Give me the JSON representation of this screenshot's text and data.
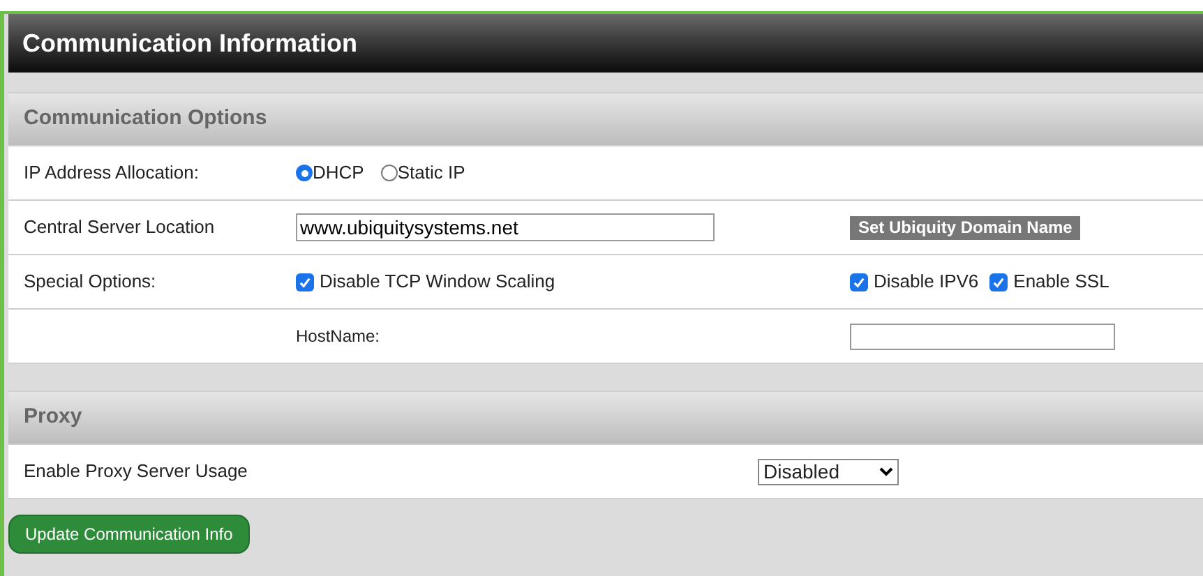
{
  "title": "Communication Information",
  "options_section": {
    "heading": "Communication Options",
    "ip_allocation": {
      "label": "IP Address Allocation:",
      "choices": [
        {
          "label": "DHCP",
          "selected": true
        },
        {
          "label": "Static IP",
          "selected": false
        }
      ]
    },
    "central_server": {
      "label": "Central Server Location",
      "value": "www.ubiquitysystems.net",
      "button": "Set Ubiquity Domain Name"
    },
    "special_options": {
      "label": "Special Options:",
      "checkboxes": [
        {
          "label": "Disable TCP Window Scaling",
          "checked": true
        },
        {
          "label": "Disable IPV6",
          "checked": true
        },
        {
          "label": "Enable SSL",
          "checked": true
        }
      ]
    },
    "hostname": {
      "label": "HostName:"
    }
  },
  "proxy_section": {
    "heading": "Proxy",
    "label": "Enable Proxy Server Usage",
    "value": "Disabled"
  },
  "submit_button": "Update Communication Info"
}
